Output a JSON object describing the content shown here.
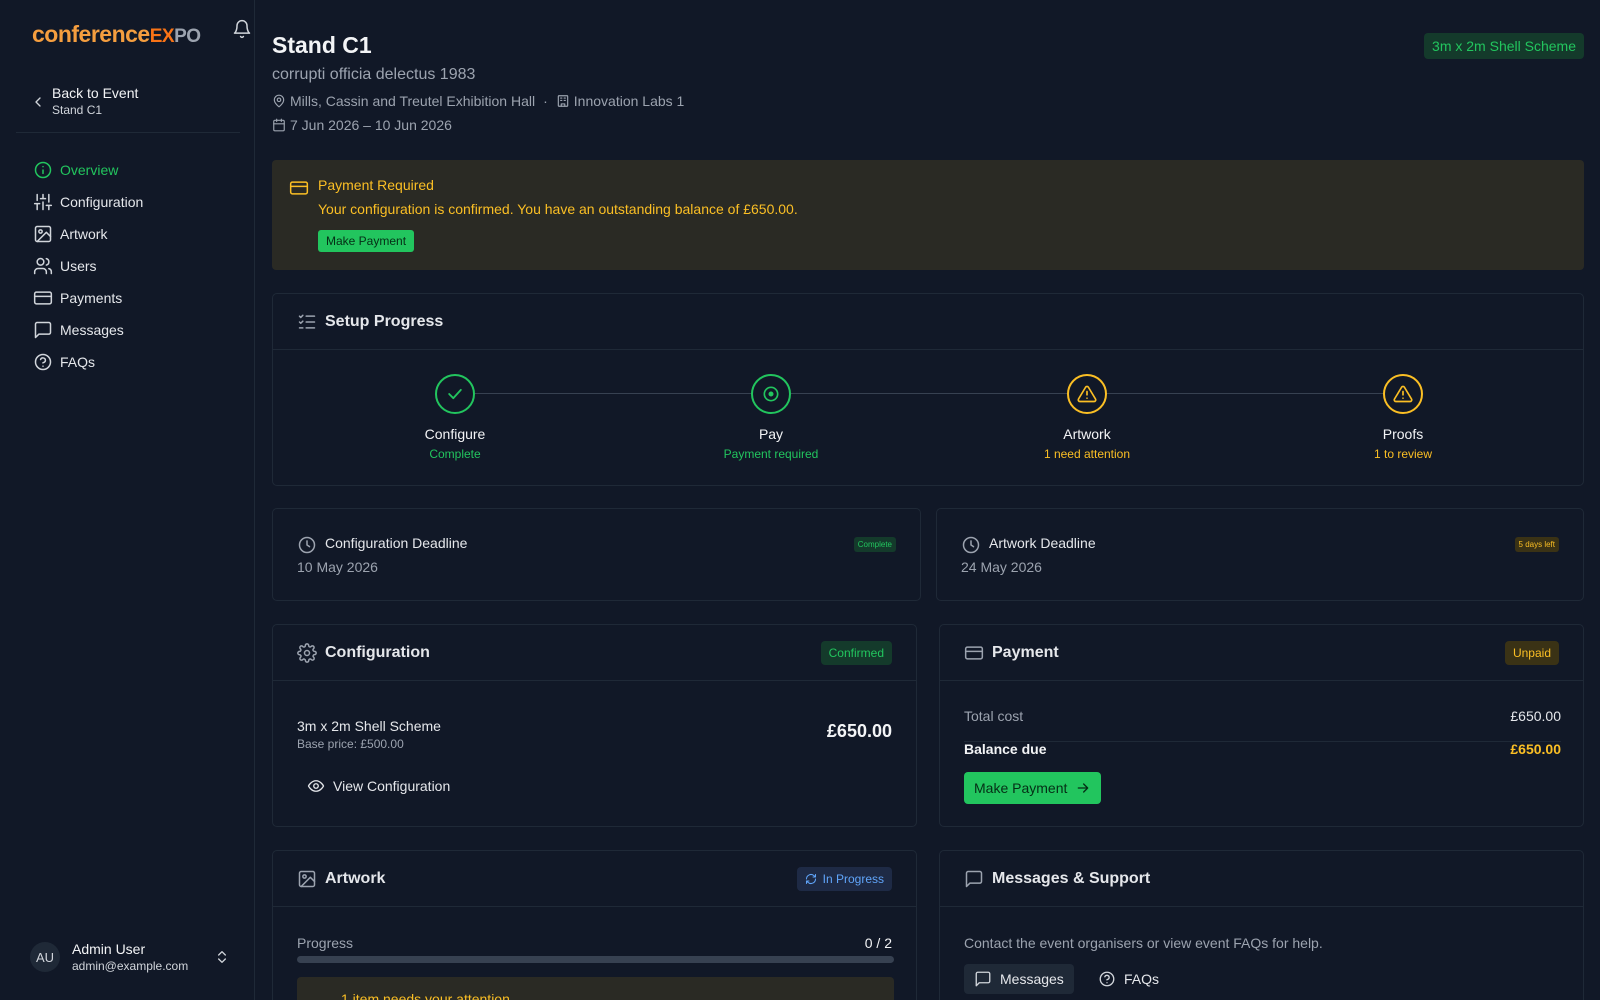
{
  "colors": {
    "accent": "#22c55e",
    "warning": "#fbbf24",
    "background": "#111827",
    "info": "#60a5fa"
  },
  "sidebar": {
    "logo": {
      "part1": "conference",
      "part2": "EX",
      "part3": "PO"
    },
    "back": {
      "label": "Back to Event",
      "sub": "Stand C1"
    },
    "items": [
      {
        "label": "Overview",
        "icon": "info-icon",
        "active": true
      },
      {
        "label": "Configuration",
        "icon": "sliders-icon"
      },
      {
        "label": "Artwork",
        "icon": "image-icon"
      },
      {
        "label": "Users",
        "icon": "users-icon"
      },
      {
        "label": "Payments",
        "icon": "credit-card-icon"
      },
      {
        "label": "Messages",
        "icon": "message-icon"
      },
      {
        "label": "FAQs",
        "icon": "help-circle-icon"
      }
    ],
    "user": {
      "initials": "AU",
      "name": "Admin User",
      "email": "admin@example.com"
    }
  },
  "header": {
    "title": "Stand C1",
    "subtitle": "corrupti officia delectus 1983",
    "venue": "Mills, Cassin and Treutel Exhibition Hall",
    "separator": "·",
    "zone": "Innovation Labs 1",
    "dates": "7 Jun 2026 – 10 Jun 2026",
    "stand_type": "3m x 2m Shell Scheme"
  },
  "alert": {
    "title": "Payment Required",
    "message": "Your configuration is confirmed. You have an outstanding balance of £650.00.",
    "button": "Make Payment"
  },
  "setup": {
    "title": "Setup Progress",
    "steps": [
      {
        "label": "Configure",
        "status": "Complete",
        "state": "complete",
        "icon": "check-icon"
      },
      {
        "label": "Pay",
        "status": "Payment required",
        "state": "current",
        "icon": "target-icon"
      },
      {
        "label": "Artwork",
        "status": "1 need attention",
        "state": "warning",
        "icon": "alert-triangle-icon"
      },
      {
        "label": "Proofs",
        "status": "1 to review",
        "state": "warning",
        "icon": "alert-triangle-icon"
      }
    ]
  },
  "deadlines": {
    "configuration": {
      "title": "Configuration Deadline",
      "date": "10 May 2026",
      "badge": "Complete"
    },
    "artwork": {
      "title": "Artwork Deadline",
      "date": "24 May 2026",
      "badge": "5 days left"
    }
  },
  "configuration": {
    "title": "Configuration",
    "badge": "Confirmed",
    "product": "3m x 2m Shell Scheme",
    "base_price": "Base price: £500.00",
    "price": "£650.00",
    "view_button": "View Configuration"
  },
  "payment": {
    "title": "Payment",
    "badge": "Unpaid",
    "total_label": "Total cost",
    "total_value": "£650.00",
    "balance_label": "Balance due",
    "balance_value": "£650.00",
    "button": "Make Payment"
  },
  "artwork": {
    "title": "Artwork",
    "badge": "In Progress",
    "progress_label": "Progress",
    "progress_value": "0 / 2",
    "progress_fraction": 0,
    "warning": "1 item needs your attention"
  },
  "messages": {
    "title": "Messages & Support",
    "text": "Contact the event organisers or view event FAQs for help.",
    "messages_button": "Messages",
    "faqs_button": "FAQs"
  }
}
